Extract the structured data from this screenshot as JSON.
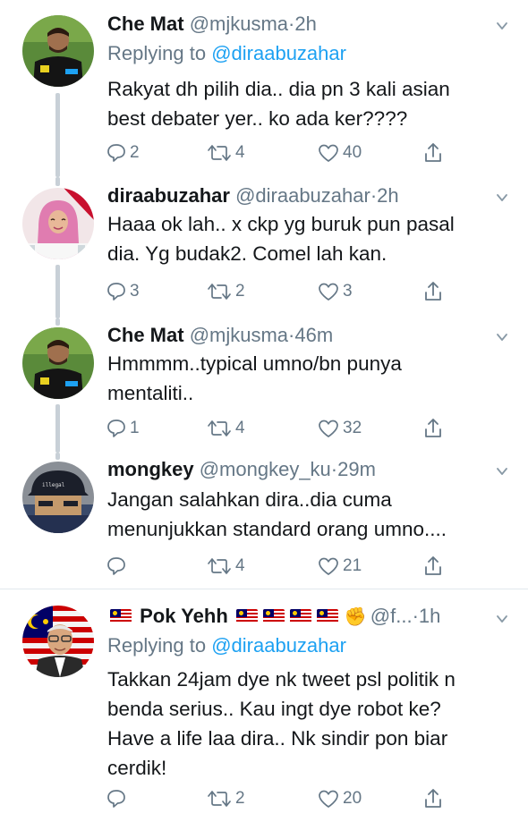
{
  "tweets": [
    {
      "display_name": "Che Mat",
      "handle": "@mjkusma",
      "time": "2h",
      "replying_prefix": "Replying to",
      "replying_to": "@diraabuzahar",
      "text_lines": [
        "Rakyat dh pilih dia.. dia pn 3 kali asian",
        "best debater yer.. ko ada ker????"
      ],
      "reply_count": "2",
      "retweet_count": "4",
      "like_count": "40",
      "avatar_icon": "soccer-player-avatar"
    },
    {
      "display_name": "diraabuzahar",
      "handle": "@diraabuzahar",
      "time": "2h",
      "text_lines": [
        "Haaa ok lah.. x ckp yg buruk pun pasal",
        "dia. Yg budak2. Comel lah kan."
      ],
      "reply_count": "3",
      "retweet_count": "2",
      "like_count": "3",
      "avatar_icon": "hijab-woman-avatar"
    },
    {
      "display_name": "Che Mat",
      "handle": "@mjkusma",
      "time": "46m",
      "text_lines": [
        "Hmmmm..typical umno/bn punya",
        "mentaliti.."
      ],
      "reply_count": "1",
      "retweet_count": "4",
      "like_count": "32",
      "avatar_icon": "soccer-player-avatar"
    },
    {
      "display_name": "mongkey",
      "handle": "@mongkey_ku",
      "time": "29m",
      "text_lines": [
        "Jangan salahkan dira..dia cuma",
        "menunjukkan standard orang umno...."
      ],
      "reply_count": "",
      "retweet_count": "4",
      "like_count": "21",
      "avatar_icon": "cap-man-avatar"
    },
    {
      "display_name": "Pok Yehh",
      "handle": "@f...",
      "time": "1h",
      "replying_prefix": "Replying to",
      "replying_to": "@diraabuzahar",
      "text_lines": [
        "Takkan 24jam dye nk tweet psl politik n",
        "benda serius.. Kau ingt dye robot ke?",
        "Have a life laa dira.. Nk sindir pon biar",
        "cerdik!"
      ],
      "reply_count": "",
      "retweet_count": "2",
      "like_count": "20",
      "avatar_icon": "elderly-man-flag-avatar",
      "name_emojis": [
        "malaysia-flag",
        "malaysia-flag",
        "malaysia-flag",
        "malaysia-flag",
        "raised-fist"
      ]
    }
  ],
  "separator": "·",
  "colors": {
    "text": "#14171a",
    "secondary": "#657786",
    "link": "#1da1f2",
    "thread_line": "#c8d0d7",
    "divider": "#e1e8ed"
  }
}
